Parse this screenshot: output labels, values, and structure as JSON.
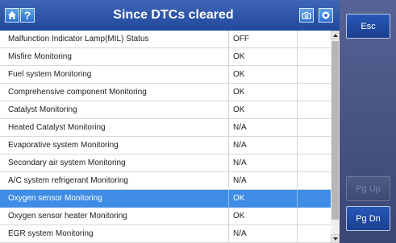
{
  "header": {
    "title": "Since DTCs cleared",
    "home_icon": "home-icon",
    "help_label": "?",
    "camera_icon": "camera-icon",
    "record_icon": "record-icon"
  },
  "side": {
    "esc_label": "Esc",
    "pgup_label": "Pg Up",
    "pgdn_label": "Pg Dn"
  },
  "rows": [
    {
      "name": "Malfunction Indicator Lamp(MIL) Status",
      "value": "OFF"
    },
    {
      "name": "Misfire Monitoring",
      "value": "OK"
    },
    {
      "name": "Fuel system Monitoring",
      "value": "OK"
    },
    {
      "name": "Comprehensive component Monitoring",
      "value": "OK"
    },
    {
      "name": "Catalyst Monitoring",
      "value": "OK"
    },
    {
      "name": "Heated Catalyst Monitoring",
      "value": "N/A"
    },
    {
      "name": "Evaporative system Monitoring",
      "value": "N/A"
    },
    {
      "name": "Secondary air system Monitoring",
      "value": "N/A"
    },
    {
      "name": "A/C system refrigerant Monitoring",
      "value": "N/A"
    },
    {
      "name": "Oxygen sensor Monitoring",
      "value": "OK"
    },
    {
      "name": "Oxygen sensor heater Monitoring",
      "value": "OK"
    },
    {
      "name": "EGR system Monitoring",
      "value": "N/A"
    }
  ],
  "selected_row": "Oxygen sensor Monitoring",
  "colors": {
    "header": "#2e55a8",
    "selected": "#3f8ce6",
    "side_panel": "#48557f"
  }
}
